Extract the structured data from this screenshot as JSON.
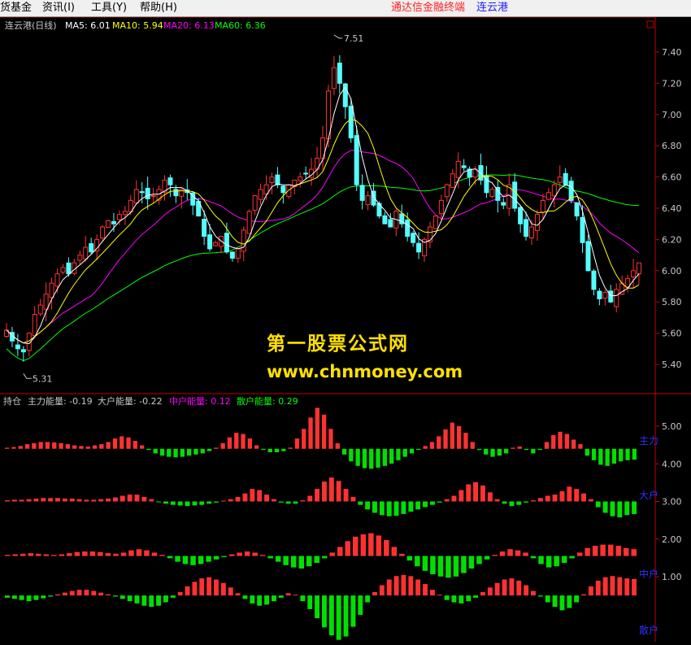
{
  "menubar": {
    "items": [
      {
        "label": "货基金"
      },
      {
        "label": "资讯(I)"
      },
      {
        "label": "工具(Y)"
      },
      {
        "label": "帮助(H)"
      }
    ],
    "platform_title": "通达信金融终端",
    "stock_title": "连云港"
  },
  "colors": {
    "up": "#ff3232",
    "down": "#54ffff",
    "ma5": "#ffffff",
    "ma10": "#ffff00",
    "ma20": "#ff00ff",
    "ma60": "#00ff00",
    "axis": "#c00000",
    "green_bar": "#00e000",
    "blue_label": "#3030ff",
    "watermark": "#ffe000"
  },
  "price_panel": {
    "header": {
      "name": "连云港(日线)",
      "ma5_label": "MA5: 6.01",
      "ma10_label": "MA10: 5.94",
      "ma20_label": "MA20: 6.13",
      "ma60_label": "MA60: 6.36"
    },
    "y_ticks": [
      "7.40",
      "7.20",
      "7.00",
      "6.80",
      "6.60",
      "6.40",
      "6.20",
      "6.00",
      "5.80",
      "5.60",
      "5.40"
    ],
    "high_label": "7.51",
    "low_label": "5.31"
  },
  "indicator_panel": {
    "header": {
      "name": "持仓",
      "main_label": "主力能量: -0.19",
      "big_label": "大户能量: -0.22",
      "mid_label": "中户能量: 0.12",
      "retail_label": "散户能量: 0.29"
    },
    "y_ticks": [
      "5.00",
      "4.00",
      "3.00",
      "2.00",
      "1.00"
    ],
    "side_labels": [
      "主力",
      "大户",
      "中户",
      "散户"
    ]
  },
  "watermark": {
    "line1": "第一股票公式网",
    "line2": "www.chnmoney.com"
  },
  "chart_data": [
    {
      "type": "candlestick",
      "title": "连云港(日线)",
      "ylim": [
        5.3,
        7.6
      ],
      "y_ticks": [
        7.4,
        7.2,
        7.0,
        6.8,
        6.6,
        6.4,
        6.2,
        6.0,
        5.8,
        5.6,
        5.4
      ],
      "annotations": [
        {
          "text": "7.51",
          "value": 7.51
        },
        {
          "text": "5.31",
          "value": 5.31
        }
      ],
      "close_path": [
        5.62,
        5.55,
        5.5,
        5.48,
        5.6,
        5.72,
        5.78,
        5.85,
        5.92,
        5.98,
        6.02,
        5.98,
        6.05,
        6.1,
        6.15,
        6.12,
        6.2,
        6.28,
        6.32,
        6.3,
        6.36,
        6.38,
        6.45,
        6.52,
        6.5,
        6.46,
        6.48,
        6.52,
        6.58,
        6.55,
        6.48,
        6.52,
        6.5,
        6.42,
        6.35,
        6.22,
        6.14,
        6.18,
        6.22,
        6.12,
        6.08,
        6.14,
        6.26,
        6.38,
        6.48,
        6.52,
        6.55,
        6.6,
        6.55,
        6.5,
        6.55,
        6.58,
        6.6,
        6.62,
        6.65,
        6.72,
        6.85,
        7.15,
        7.3,
        7.2,
        7.05,
        6.85,
        6.55,
        6.45,
        6.48,
        6.42,
        6.35,
        6.3,
        6.28,
        6.38,
        6.3,
        6.22,
        6.18,
        6.12,
        6.2,
        6.28,
        6.35,
        6.45,
        6.55,
        6.62,
        6.7,
        6.66,
        6.6,
        6.65,
        6.58,
        6.5,
        6.52,
        6.45,
        6.42,
        6.55,
        6.4,
        6.3,
        6.22,
        6.28,
        6.36,
        6.45,
        6.5,
        6.55,
        6.6,
        6.55,
        6.45,
        6.35,
        6.18,
        6.0,
        5.88,
        5.82,
        5.86,
        5.8,
        5.88,
        5.92,
        5.95,
        6.0,
        6.05
      ],
      "ma_series": [
        {
          "name": "MA5",
          "value": 6.01
        },
        {
          "name": "MA10",
          "value": 5.94
        },
        {
          "name": "MA20",
          "value": 6.13
        },
        {
          "name": "MA60",
          "value": 6.36
        }
      ]
    },
    {
      "type": "bar",
      "title": "持仓",
      "ylim": [
        0,
        5.5
      ],
      "y_ticks": [
        5.0,
        4.0,
        3.0,
        2.0,
        1.0
      ],
      "series": [
        {
          "name": "主力能量",
          "last": -0.19,
          "baseline": 4.4,
          "values": [
            0.02,
            0.03,
            0.05,
            0.08,
            0.1,
            0.12,
            0.12,
            0.11,
            0.1,
            0.08,
            0.06,
            0.05,
            0.04,
            0.06,
            0.08,
            0.12,
            0.18,
            0.22,
            0.2,
            0.14,
            0.06,
            -0.02,
            -0.08,
            -0.12,
            -0.14,
            -0.15,
            -0.14,
            -0.12,
            -0.1,
            -0.08,
            -0.04,
            0.02,
            0.1,
            0.2,
            0.28,
            0.26,
            0.18,
            0.06,
            -0.02,
            -0.06,
            -0.06,
            -0.04,
            0.02,
            0.18,
            0.35,
            0.55,
            0.72,
            0.6,
            0.35,
            0.1,
            -0.1,
            -0.22,
            -0.3,
            -0.34,
            -0.35,
            -0.33,
            -0.3,
            -0.26,
            -0.2,
            -0.14,
            -0.08,
            -0.02,
            0.05,
            0.12,
            0.22,
            0.34,
            0.46,
            0.4,
            0.28,
            0.12,
            -0.02,
            -0.1,
            -0.14,
            -0.12,
            -0.08,
            0.02,
            0.04,
            -0.02,
            -0.08,
            -0.02,
            0.12,
            0.24,
            0.3,
            0.26,
            0.16,
            0.08,
            -0.12,
            -0.2,
            -0.28,
            -0.3,
            -0.26,
            -0.22,
            -0.2,
            -0.19
          ]
        },
        {
          "name": "大户能量",
          "last": -0.22,
          "baseline": 3.0,
          "values": [
            0.02,
            0.03,
            0.03,
            0.04,
            0.05,
            0.06,
            0.06,
            0.06,
            0.05,
            0.05,
            0.04,
            0.03,
            0.03,
            0.04,
            0.05,
            0.07,
            0.1,
            0.12,
            0.12,
            0.08,
            0.04,
            -0.01,
            -0.04,
            -0.06,
            -0.07,
            -0.08,
            -0.07,
            -0.06,
            -0.04,
            -0.02,
            0.0,
            0.04,
            0.08,
            0.14,
            0.22,
            0.2,
            0.12,
            0.04,
            -0.02,
            -0.04,
            -0.04,
            0.02,
            0.1,
            0.22,
            0.35,
            0.42,
            0.36,
            0.22,
            0.08,
            -0.06,
            -0.14,
            -0.2,
            -0.24,
            -0.26,
            -0.25,
            -0.22,
            -0.18,
            -0.14,
            -0.1,
            -0.06,
            -0.02,
            0.04,
            0.1,
            0.2,
            0.3,
            0.34,
            0.28,
            0.16,
            0.04,
            -0.04,
            -0.08,
            -0.06,
            -0.02,
            0.02,
            0.06,
            0.1,
            0.12,
            0.18,
            0.26,
            0.22,
            0.14,
            0.04,
            -0.1,
            -0.2,
            -0.26,
            -0.28,
            -0.24,
            -0.22
          ]
        },
        {
          "name": "中户能量",
          "last": 0.12,
          "baseline": 1.55,
          "values": [
            0.02,
            0.03,
            0.04,
            0.05,
            0.04,
            0.03,
            0.02,
            0.03,
            0.05,
            0.07,
            0.08,
            0.08,
            0.07,
            0.05,
            0.04,
            0.06,
            0.1,
            0.12,
            0.1,
            0.06,
            0.02,
            -0.04,
            -0.1,
            -0.14,
            -0.16,
            -0.14,
            -0.1,
            -0.06,
            -0.02,
            0.03,
            0.06,
            0.08,
            0.06,
            0.02,
            -0.04,
            -0.1,
            -0.16,
            -0.2,
            -0.22,
            -0.18,
            -0.12,
            -0.04,
            0.06,
            0.16,
            0.26,
            0.34,
            0.38,
            0.4,
            0.36,
            0.28,
            0.16,
            0.04,
            -0.08,
            -0.18,
            -0.26,
            -0.32,
            -0.36,
            -0.38,
            -0.36,
            -0.3,
            -0.22,
            -0.14,
            -0.06,
            0.02,
            0.08,
            0.12,
            0.1,
            0.06,
            -0.04,
            -0.14,
            -0.2,
            -0.18,
            -0.12,
            -0.04,
            0.06,
            0.14,
            0.18,
            0.2,
            0.2,
            0.18,
            0.14,
            0.12
          ]
        },
        {
          "name": "散户能量",
          "last": 0.29,
          "baseline": 0.5,
          "values": [
            -0.04,
            -0.06,
            -0.08,
            -0.1,
            -0.08,
            -0.05,
            -0.02,
            0.02,
            0.05,
            0.08,
            0.1,
            0.1,
            0.08,
            0.05,
            0.02,
            -0.02,
            -0.06,
            -0.1,
            -0.14,
            -0.18,
            -0.2,
            -0.18,
            -0.12,
            -0.04,
            0.06,
            0.16,
            0.24,
            0.3,
            0.32,
            0.28,
            0.22,
            0.14,
            0.04,
            -0.06,
            -0.14,
            -0.18,
            -0.16,
            -0.1,
            -0.04,
            0.04,
            0.0,
            -0.1,
            -0.24,
            -0.4,
            -0.56,
            -0.7,
            -0.78,
            -0.72,
            -0.55,
            -0.34,
            -0.12,
            0.06,
            0.18,
            0.28,
            0.34,
            0.36,
            0.34,
            0.28,
            0.2,
            0.1,
            0.0,
            -0.08,
            -0.12,
            -0.14,
            -0.1,
            -0.04,
            0.06,
            0.14,
            0.22,
            0.28,
            0.3,
            0.26,
            0.18,
            0.08,
            -0.02,
            -0.12,
            -0.2,
            -0.26,
            -0.22,
            -0.12,
            0.02,
            0.16,
            0.26,
            0.32,
            0.34,
            0.32,
            0.3,
            0.29
          ]
        }
      ]
    }
  ]
}
